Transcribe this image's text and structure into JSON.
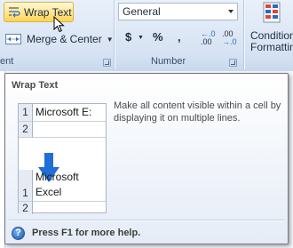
{
  "ribbon": {
    "alignment": {
      "wrap_text_label": "Wrap Text",
      "merge_center_label": "Merge & Center",
      "group_label_partial": "ent"
    },
    "number": {
      "format_selected": "General",
      "currency_symbol": "$",
      "percent_symbol": "%",
      "comma_symbol": ",",
      "increase_decimal_top": "←.0",
      "increase_decimal_bottom": ".00",
      "decrease_decimal_top": ".00",
      "decrease_decimal_bottom": "→.0",
      "group_label": "Number"
    },
    "styles": {
      "conditional_label_line1": "Condition",
      "conditional_label_line2": "Formattin"
    }
  },
  "tooltip": {
    "title": "Wrap Text",
    "description": "Make all content visible within a cell by displaying it on multiple lines.",
    "help_text": "Press F1 for more help.",
    "example": {
      "before_rows": [
        {
          "num": "1",
          "text": "Microsoft E:"
        },
        {
          "num": "2",
          "text": ""
        }
      ],
      "after_rows": [
        {
          "num": "",
          "text": "Microsoft"
        },
        {
          "num": "1",
          "text": "Excel"
        },
        {
          "num": "2",
          "text": ""
        }
      ]
    }
  },
  "colors": {
    "highlight_button": "#ffe58f",
    "arrow_blue": "#1f6fd6",
    "ribbon_bg": "#dde7f5"
  }
}
